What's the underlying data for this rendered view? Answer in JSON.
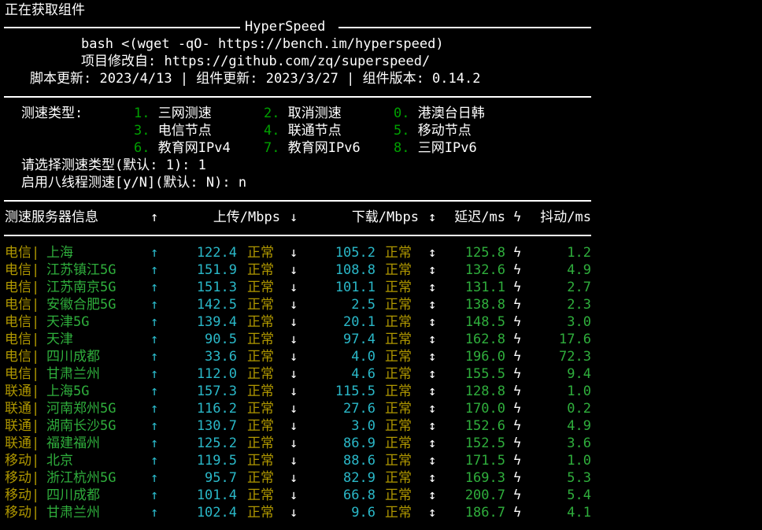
{
  "status_line": "正在获取组件",
  "banner": {
    "title": "HyperSpeed",
    "cmd": "bash <(wget -qO- https://bench.im/hyperspeed)",
    "source_label": "项目修改自:",
    "source_url": "https://github.com/zq/superspeed/",
    "update_line": "脚本更新: 2023/4/13 | 组件更新: 2023/3/27 | 组件版本: 0.14.2"
  },
  "menu": {
    "label": "测速类型:",
    "options": [
      {
        "num": "1.",
        "label": "三网测速"
      },
      {
        "num": "2.",
        "label": "取消测速"
      },
      {
        "num": "0.",
        "label": "港澳台日韩"
      },
      {
        "num": "3.",
        "label": "电信节点"
      },
      {
        "num": "4.",
        "label": "联通节点"
      },
      {
        "num": "5.",
        "label": "移动节点"
      },
      {
        "num": "6.",
        "label": "教育网IPv4"
      },
      {
        "num": "7.",
        "label": "教育网IPv6"
      },
      {
        "num": "8.",
        "label": "三网IPv6"
      }
    ],
    "prompt1": "请选择测速类型(默认: 1): 1",
    "prompt2": "启用八线程测速[y/N](默认: N): n"
  },
  "table": {
    "headers": {
      "server": "测速服务器信息",
      "up_arrow": "↑",
      "upload": "上传/Mbps",
      "down_arrow": "↓",
      "download": "下载/Mbps",
      "latency_icon": "↕",
      "latency": "延迟/ms",
      "jitter_icon": "ϟ",
      "jitter": "抖动/ms"
    },
    "ok_label": "正常",
    "rows": [
      {
        "isp": "电信",
        "sep": "|",
        "city": "上海",
        "up": "122.4",
        "down": "105.2",
        "lat": "125.8",
        "jit": "1.2"
      },
      {
        "isp": "电信",
        "sep": "|",
        "city": "江苏镇江5G",
        "up": "151.9",
        "down": "108.8",
        "lat": "132.6",
        "jit": "4.9"
      },
      {
        "isp": "电信",
        "sep": "|",
        "city": "江苏南京5G",
        "up": "151.3",
        "down": "101.1",
        "lat": "131.1",
        "jit": "2.7"
      },
      {
        "isp": "电信",
        "sep": "|",
        "city": "安徽合肥5G",
        "up": "142.5",
        "down": "2.5",
        "lat": "138.8",
        "jit": "2.3"
      },
      {
        "isp": "电信",
        "sep": "|",
        "city": "天津5G",
        "up": "139.4",
        "down": "20.1",
        "lat": "148.5",
        "jit": "3.0"
      },
      {
        "isp": "电信",
        "sep": "|",
        "city": "天津",
        "up": "90.5",
        "down": "97.4",
        "lat": "162.8",
        "jit": "17.6"
      },
      {
        "isp": "电信",
        "sep": "|",
        "city": "四川成都",
        "up": "33.6",
        "down": "4.0",
        "lat": "196.0",
        "jit": "72.3"
      },
      {
        "isp": "电信",
        "sep": "|",
        "city": "甘肃兰州",
        "up": "112.0",
        "down": "4.6",
        "lat": "155.5",
        "jit": "9.4"
      },
      {
        "isp": "联通",
        "sep": "|",
        "city": "上海5G",
        "up": "157.3",
        "down": "115.5",
        "lat": "128.8",
        "jit": "1.0"
      },
      {
        "isp": "联通",
        "sep": "|",
        "city": "河南郑州5G",
        "up": "116.2",
        "down": "27.6",
        "lat": "170.0",
        "jit": "0.2"
      },
      {
        "isp": "联通",
        "sep": "|",
        "city": "湖南长沙5G",
        "up": "130.7",
        "down": "3.0",
        "lat": "152.6",
        "jit": "4.9"
      },
      {
        "isp": "联通",
        "sep": "|",
        "city": "福建福州",
        "up": "125.2",
        "down": "86.9",
        "lat": "152.5",
        "jit": "3.6"
      },
      {
        "isp": "移动",
        "sep": "|",
        "city": "北京",
        "up": "119.5",
        "down": "88.6",
        "lat": "171.5",
        "jit": "1.0"
      },
      {
        "isp": "移动",
        "sep": "|",
        "city": "浙江杭州5G",
        "up": "95.7",
        "down": "82.9",
        "lat": "169.3",
        "jit": "5.3"
      },
      {
        "isp": "移动",
        "sep": "|",
        "city": "四川成都",
        "up": "101.4",
        "down": "66.8",
        "lat": "200.7",
        "jit": "5.4"
      },
      {
        "isp": "移动",
        "sep": "|",
        "city": "甘肃兰州",
        "up": "102.4",
        "down": "9.6",
        "lat": "186.7",
        "jit": "4.1"
      }
    ]
  }
}
